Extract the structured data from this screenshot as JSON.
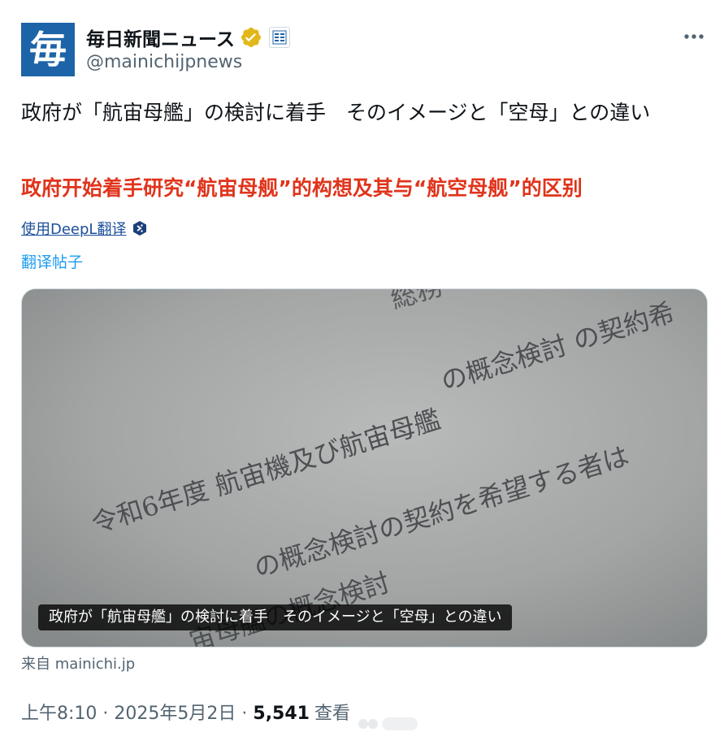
{
  "author": {
    "avatar_glyph": "毎",
    "display_name": "毎日新聞ニュース",
    "handle": "@mainichijpnews",
    "verified_icon": "gold-verified-badge",
    "affiliate_icon": "affiliate-badge"
  },
  "more_icon": "more-horizontal-icon",
  "tweet": {
    "text": "政府が「航宙母艦」の検討に着手　そのイメージと「空母」との違い",
    "overlay_translation": "政府开始着手研究“航宙母舰”的构想及其与“航空母舰”的区别",
    "deepl_label": "使用DeepL翻译",
    "translate_label": "翻译帖子"
  },
  "media": {
    "photo_text": {
      "line_top": "総務",
      "line_a": "の概念検討 の契約希",
      "line_b": "令和6年度 航宙機及び航宙母艦",
      "line_c": "の概念検討の契約を希望する者は",
      "line_d": "宙母艦の概念検討"
    },
    "caption": "政府が「航宙母艦」の検討に着手　そのイメージと「空母」との違い"
  },
  "source": "来自 mainichi.jp",
  "meta": {
    "time": "上午8:10",
    "date": "2025年5月2日",
    "views_count": "5,541",
    "views_label": "查看",
    "separator": "·"
  },
  "colors": {
    "brand_blue": "#1d63a8",
    "verified_gold": "#e2b719",
    "link_blue": "#1d9bf0",
    "overlay_red": "#e0341c",
    "muted_text": "#536471"
  }
}
